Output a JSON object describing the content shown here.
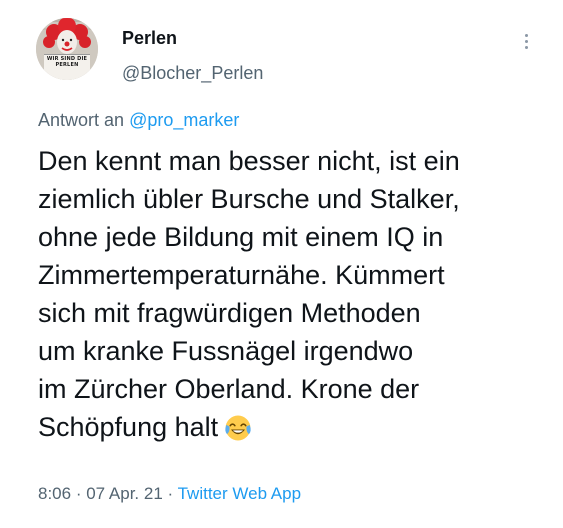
{
  "author": {
    "display_name": "Perlen",
    "handle": "@Blocher_Perlen",
    "avatar_caption_line1": "WIR SIND DIE",
    "avatar_caption_line2": "PERLEN",
    "avatar_icon": "clown-avatar"
  },
  "menu": {
    "icon": "more-vertical-icon"
  },
  "reply": {
    "prefix": "Antwort an",
    "mention": "@pro_marker"
  },
  "tweet": {
    "lines": [
      "Den kennt man besser nicht, ist ein",
      "ziemlich übler Bursche und Stalker,",
      "ohne jede Bildung mit einem IQ in",
      "Zimmertemperaturnähe. Kümmert",
      "sich mit fragwürdigen Methoden",
      "um kranke Fussnägel irgendwo",
      "im Zürcher Oberland. Krone der",
      "Schöpfung halt"
    ],
    "emoji": "face-with-tears-of-joy-icon"
  },
  "meta": {
    "time": "8:06",
    "separator": " · ",
    "date": "07 Apr. 21",
    "source": "Twitter Web App"
  },
  "colors": {
    "text": "#0f1419",
    "secondary": "#536471",
    "link": "#1d9bf0"
  }
}
